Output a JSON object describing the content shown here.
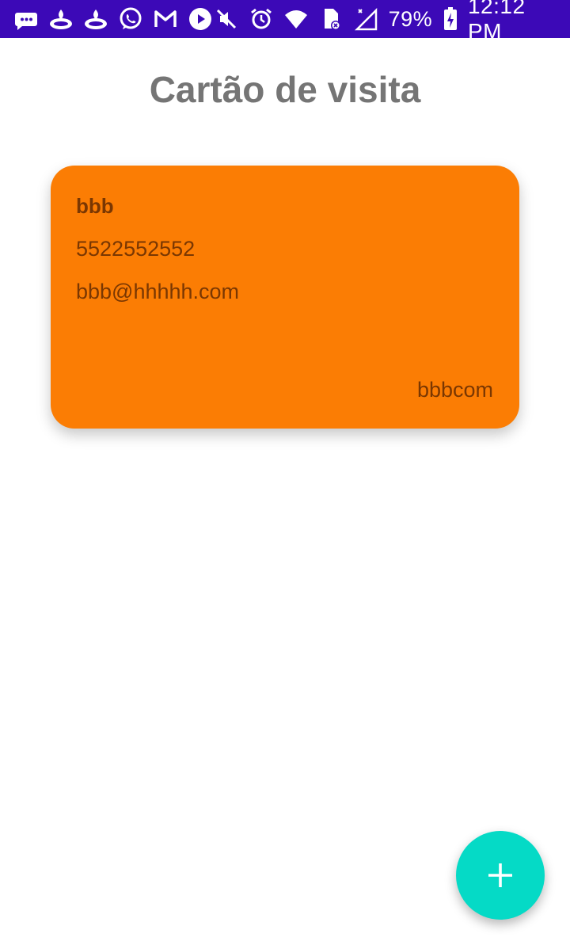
{
  "status_bar": {
    "battery_percent": "79%",
    "time": "12:12 PM",
    "background_color": "#3c09b7",
    "left_icons": [
      "messages-icon",
      "santander-icon",
      "santander-icon",
      "whatsapp-icon",
      "gmail-icon",
      "youtube-icon"
    ],
    "right_icons": [
      "mute-icon",
      "alarm-icon",
      "wifi-icon",
      "sim-card-icon",
      "no-signal-icon",
      "battery-icon"
    ]
  },
  "page": {
    "title": "Cartão de visita"
  },
  "card": {
    "name": "bbb",
    "phone": "5522552552",
    "email": "bbb@hhhhh.com",
    "company": "bbbcom",
    "background_color": "#fb7d04",
    "text_color": "#7a3702"
  },
  "fab": {
    "icon": "plus-icon",
    "background_color": "#05dac6"
  }
}
